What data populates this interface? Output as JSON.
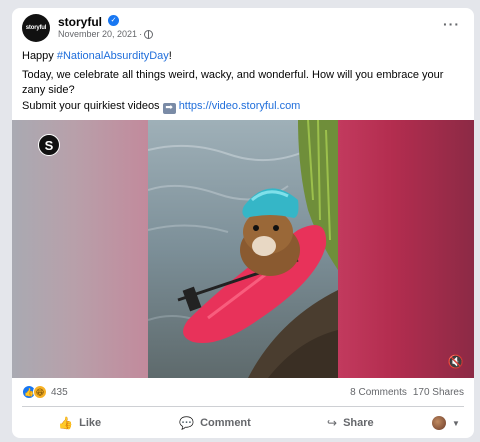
{
  "post": {
    "page_name": "storyful",
    "avatar_text": "storyful",
    "date": "November 20, 2021",
    "meta_sep": "·",
    "more_label": "···",
    "line1_prefix": "Happy ",
    "hashtag": "#NationalAbsurdityDay",
    "line1_suffix": "!",
    "body": "Today, we celebrate all things weird, wacky, and wonderful. How will you embrace your zany side?",
    "submit_text": "Submit your quirkiest videos",
    "submit_arrow": "➡",
    "submit_link": "https://video.storyful.com"
  },
  "video": {
    "logo_letter": "S",
    "mute_icon": "🔇"
  },
  "stats": {
    "reaction_count": "435",
    "comments": "8 Comments",
    "shares": "170 Shares"
  },
  "actions": {
    "like": "Like",
    "comment": "Comment",
    "share": "Share"
  },
  "icons": {
    "like": "👍",
    "comment": "💬",
    "share": "↪",
    "haha": "😆",
    "thumb": "👍"
  },
  "colors": {
    "link": "#216fdb",
    "verified": "#1877f2",
    "kayak": "#e8325a",
    "helmet": "#35b6c7"
  }
}
